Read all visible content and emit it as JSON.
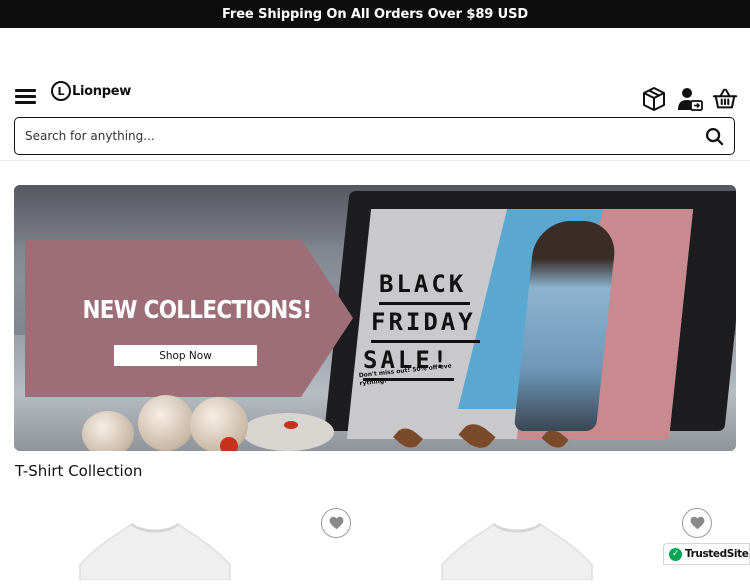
{
  "announcement": {
    "text": "Free Shipping On All Orders Over $89 USD"
  },
  "header": {
    "logo_letter": "L",
    "logo_text": "Lionpew",
    "icons": [
      "menu-icon",
      "package-tracking-icon",
      "account-icon",
      "cart-icon"
    ]
  },
  "search": {
    "placeholder": "Search for anything..."
  },
  "banner": {
    "headline": "NEW COLLECTIONS!",
    "button_label": "Shop Now",
    "sale_line1": "BLACK",
    "sale_line2": "FRIDAY",
    "sale_line3": "SALE!",
    "sale_subtext": "Don't miss out! 50% off eve rything!"
  },
  "collection": {
    "title": "T-Shirt Collection"
  },
  "badge": {
    "label": "TrustedSite"
  },
  "colors": {
    "announcement_bg": "#0d0d0d",
    "promo_panel": "#9d6e78",
    "trust_green": "#00a651"
  }
}
